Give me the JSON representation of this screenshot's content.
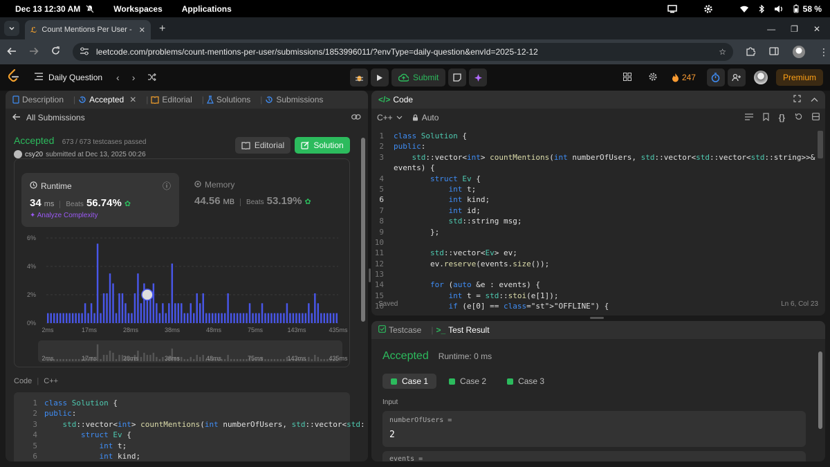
{
  "os": {
    "datetime": "Dec 13  12:30 AM",
    "menus": [
      "Workspaces",
      "Applications"
    ],
    "battery": "58 %"
  },
  "browser": {
    "tab_title": "Count Mentions Per User - Le",
    "url": "leetcode.com/problems/count-mentions-per-user/submissions/1853996011/?envType=daily-question&envId=2025-12-12"
  },
  "lc": {
    "daily": "Daily Question",
    "submit": "Submit",
    "streak": "247",
    "premium": "Premium"
  },
  "left": {
    "tabs": [
      "Description",
      "Accepted",
      "Editorial",
      "Solutions",
      "Submissions"
    ],
    "all_submissions": "All Submissions",
    "status": "Accepted",
    "testcases": "673 / 673 testcases passed",
    "user": "csy20",
    "submitted": "submitted at Dec 13, 2025 00:26",
    "editorial_btn": "Editorial",
    "solution_btn": "Solution",
    "runtime": {
      "label": "Runtime",
      "value": "34",
      "unit": "ms",
      "beats_label": "Beats",
      "beats": "56.74%",
      "analyze": "Analyze Complexity"
    },
    "memory": {
      "label": "Memory",
      "value": "44.56",
      "unit": "MB",
      "beats_label": "Beats",
      "beats": "53.19%"
    },
    "code_label": "Code",
    "code_lang": "C++"
  },
  "chart_data": {
    "type": "bar",
    "title": "",
    "xlabel": "",
    "ylabel": "",
    "y_ticks": [
      "6%",
      "4%",
      "2%",
      "0%"
    ],
    "ylim": [
      0,
      6
    ],
    "x_ticks": [
      "2ms",
      "17ms",
      "28ms",
      "38ms",
      "48ms",
      "75ms",
      "143ms",
      "435ms"
    ],
    "values": [
      0.7,
      0.7,
      0.7,
      0.7,
      0.7,
      0.7,
      0.7,
      0.7,
      0.7,
      0.7,
      0.7,
      0.7,
      1.4,
      0.7,
      1.4,
      0.7,
      5.6,
      0.7,
      2.1,
      2.1,
      3.5,
      2.8,
      0.7,
      2.1,
      2.1,
      1.4,
      0.7,
      0.7,
      2.1,
      3.5,
      1.4,
      2.8,
      2.1,
      2.1,
      2.8,
      1.4,
      0.7,
      1.4,
      0.7,
      1.4,
      4.2,
      1.4,
      1.4,
      1.4,
      0.7,
      0.7,
      1.4,
      0.7,
      2.1,
      1.4,
      2.1,
      0.7,
      0.7,
      0.7,
      0.7,
      0.7,
      0.7,
      0.7,
      2.1,
      0.7,
      0.7,
      0.7,
      0.7,
      0.7,
      0.7,
      1.4,
      0.7,
      0.7,
      0.7,
      1.4,
      0.7,
      0.7,
      0.7,
      0.7,
      0.7,
      0.7,
      0.7,
      1.4,
      0.7,
      0.7,
      0.7,
      0.7,
      0.7,
      0.7,
      1.4,
      0.7,
      2.1,
      1.4,
      0.7,
      0.7,
      0.7,
      0.7,
      0.7,
      0.7
    ],
    "grid": true
  },
  "left_code": [
    "class Solution {",
    "public:",
    "    std::vector<int> countMentions(int numberOfUsers, std::vector<std:",
    "        struct Ev {",
    "            int t;",
    "            int kind;"
  ],
  "code": {
    "tab": "Code",
    "lang": "C++",
    "mode": "Auto",
    "saved": "Saved",
    "position": "Ln 6, Col 23",
    "lines": [
      "class Solution {",
      "public:",
      "    std::vector<int> countMentions(int numberOfUsers, std::vector<std::vector<std::string>>&",
      "events) {",
      "        struct Ev {",
      "            int t;",
      "            int kind;",
      "            int id;",
      "            std::string msg;",
      "        };",
      "",
      "        std::vector<Ev> ev;",
      "        ev.reserve(events.size());",
      "",
      "        for (auto &e : events) {",
      "            int t = std::stoi(e[1]);",
      "            if (e[0] == \"OFFLINE\") {"
    ],
    "line_numbers": [
      "1",
      "2",
      "3",
      "",
      "4",
      "5",
      "6",
      "7",
      "8",
      "9",
      "10",
      "11",
      "12",
      "13",
      "14",
      "15",
      "16"
    ]
  },
  "test": {
    "tabs": [
      "Testcase",
      "Test Result"
    ],
    "status": "Accepted",
    "runtime": "Runtime: 0 ms",
    "cases": [
      "Case 1",
      "Case 2",
      "Case 3"
    ],
    "input_label": "Input",
    "var1": "numberOfUsers =",
    "val1": "2",
    "var2": "events ="
  }
}
